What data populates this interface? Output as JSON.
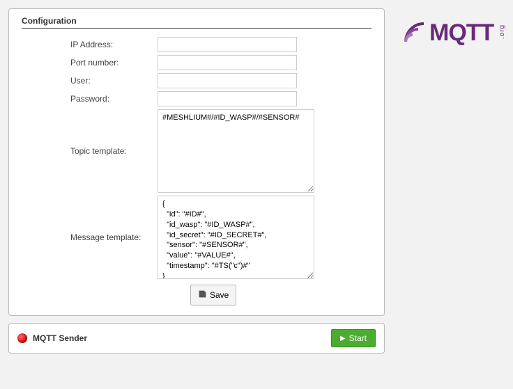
{
  "logo": {
    "text": "MQTT",
    "org": ".org"
  },
  "config": {
    "title": "Configuration",
    "labels": {
      "ip": "IP Address:",
      "port": "Port number:",
      "user": "User:",
      "password": "Password:",
      "topic": "Topic template:",
      "message": "Message template:"
    },
    "values": {
      "ip": "",
      "port": "",
      "user": "",
      "password": "",
      "topic": "#MESHLIUM#/#ID_WASP#/#SENSOR#",
      "message": "{\n  \"id\": \"#ID#\",\n  \"id_wasp\": \"#ID_WASP#\",\n  \"id_secret\": \"#ID_SECRET#\",\n  \"sensor\": \"#SENSOR#\",\n  \"value\": \"#VALUE#\",\n  \"timestamp\": \"#TS(\"c\")#\"\n}"
    },
    "save_label": "Save"
  },
  "sender": {
    "title": "MQTT Sender",
    "status": "stopped",
    "start_label": "Start"
  }
}
